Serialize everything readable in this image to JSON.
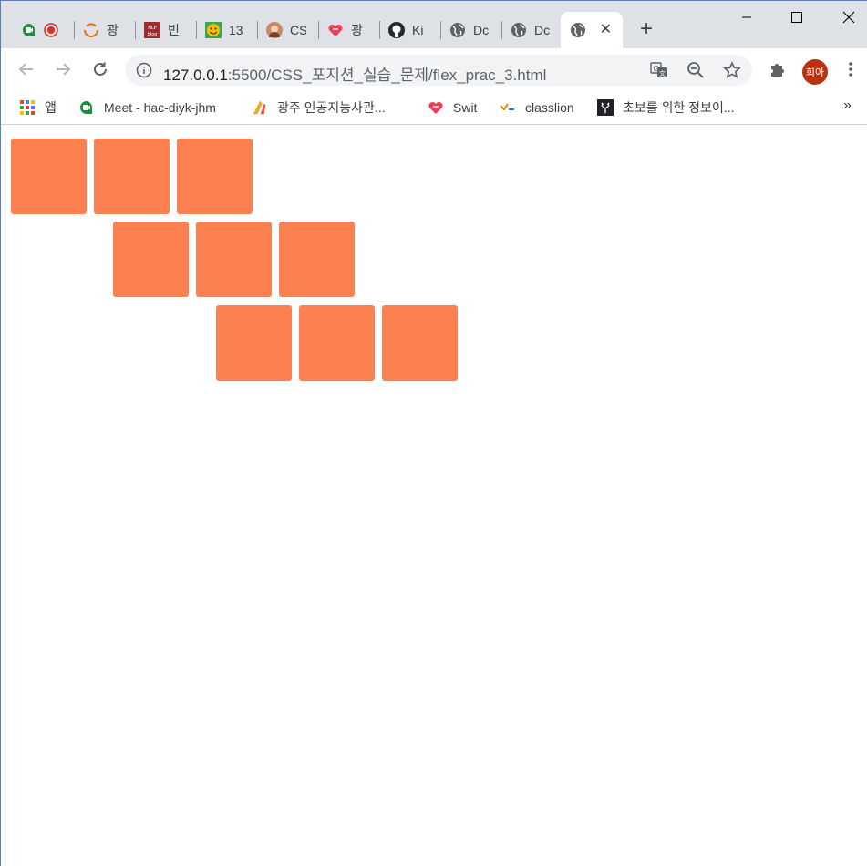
{
  "browser": {
    "tabs": [
      {
        "title": "",
        "icon": "meet-icon"
      },
      {
        "title": "광",
        "icon": "ring-icon"
      },
      {
        "title": "빈",
        "icon": "nlp-blog-icon"
      },
      {
        "title": "13",
        "icon": "smiley-icon"
      },
      {
        "title": "CS",
        "icon": "profile-icon"
      },
      {
        "title": "광",
        "icon": "heart-icon"
      },
      {
        "title": "Ki",
        "icon": "github-icon"
      },
      {
        "title": "Dc",
        "icon": "globe-icon"
      },
      {
        "title": "Dc",
        "icon": "globe-icon"
      },
      {
        "title": "",
        "icon": "globe-icon",
        "active": true
      }
    ],
    "address": {
      "host": "127.0.0.1",
      "rest": ":5500/CSS_포지션_실습_문제/flex_prac_3.html"
    },
    "profile_initials": "희아",
    "bookmarks": [
      {
        "label": "앱",
        "icon": "apps-icon"
      },
      {
        "label": "Meet - hac-diyk-jhm",
        "icon": "meet-icon"
      },
      {
        "label": "광주 인공지능사관...",
        "icon": "ai-icon"
      },
      {
        "label": "Swit",
        "icon": "heart-icon"
      },
      {
        "label": "classlion",
        "icon": "classlion-icon"
      },
      {
        "label": "초보를 위한 정보이...",
        "icon": "deer-icon"
      }
    ],
    "bookmarks_more": "»"
  },
  "page": {
    "box_color": "#fd8050",
    "rows": [
      3,
      3,
      3
    ]
  }
}
